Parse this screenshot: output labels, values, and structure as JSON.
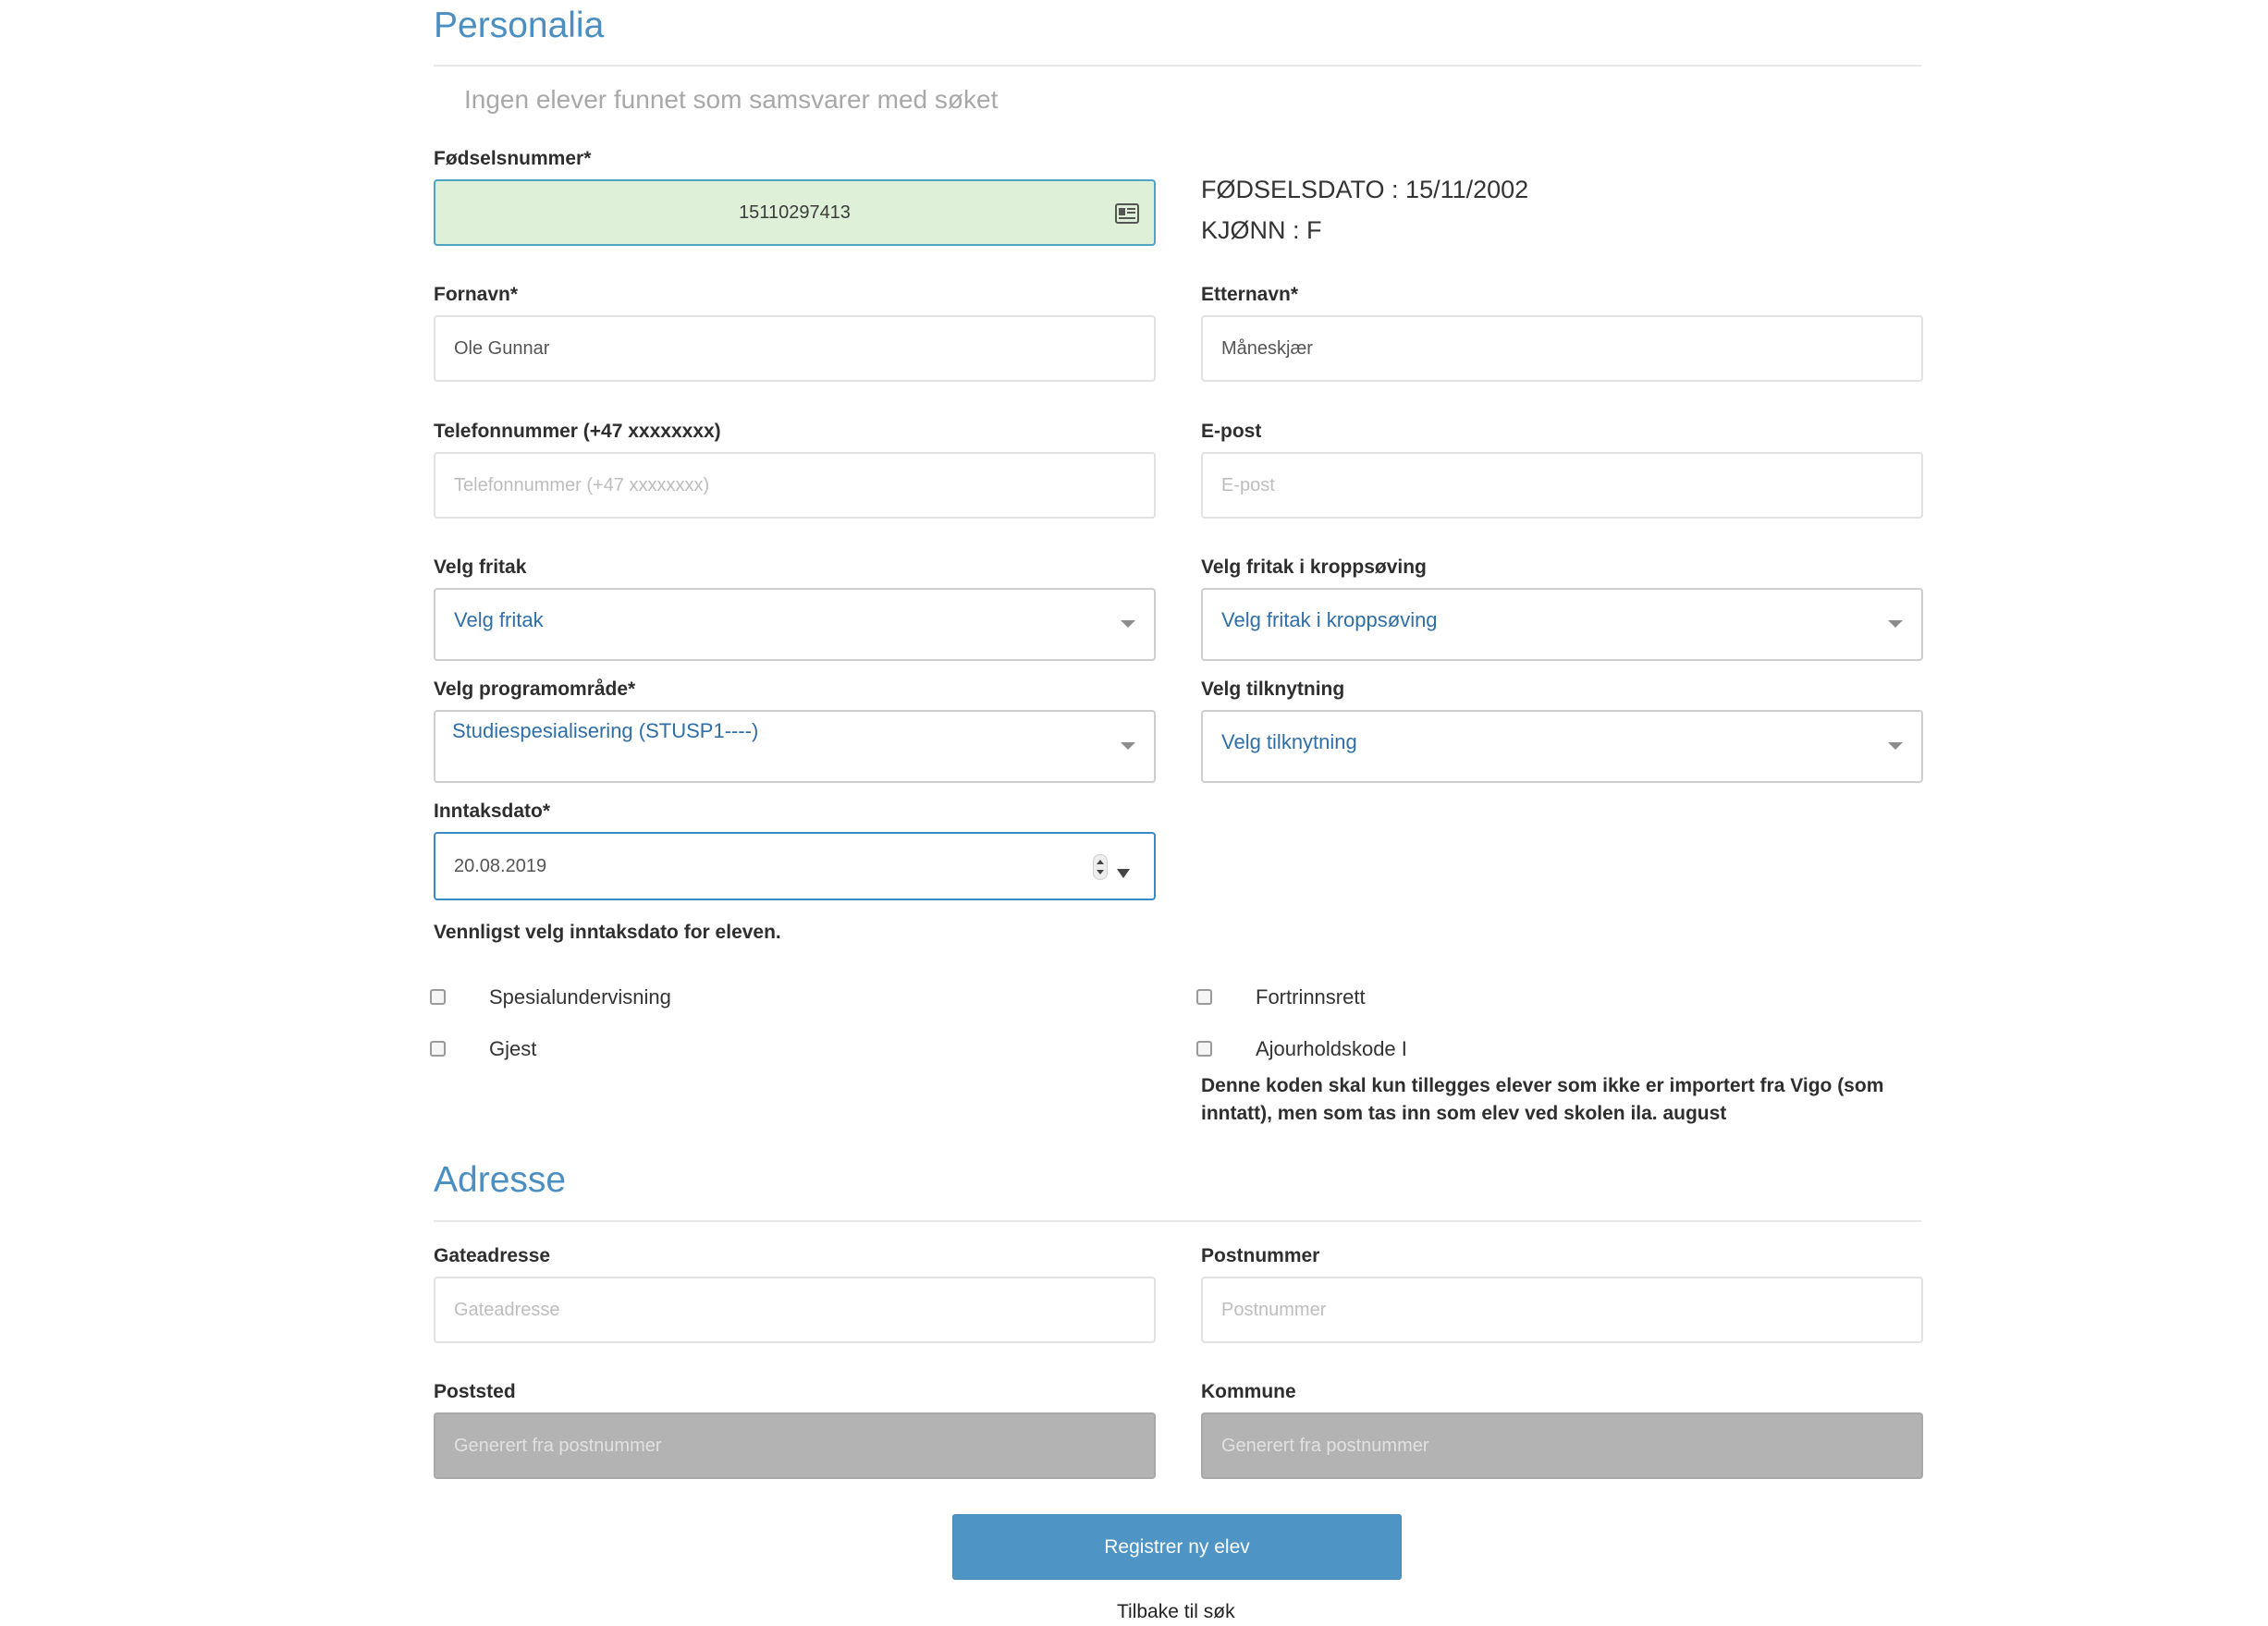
{
  "personalia": {
    "title": "Personalia",
    "notice": "Ingen elever funnet som samsvarer med søket",
    "fodselsnummer_label": "Fødselsnummer*",
    "fodselsnummer_value": "15110297413",
    "fodselsdato": "FØDSELSDATO : 15/11/2002",
    "kjonn": "KJØNN : F",
    "fornavn_label": "Fornavn*",
    "fornavn_value": "Ole Gunnar",
    "etternavn_label": "Etternavn*",
    "etternavn_value": "Måneskjær",
    "telefon_label": "Telefonnummer (+47 xxxxxxxx)",
    "telefon_placeholder": "Telefonnummer (+47 xxxxxxxx)",
    "epost_label": "E-post",
    "epost_placeholder": "E-post",
    "fritak_label": "Velg fritak",
    "fritak_value": "Velg fritak",
    "fritak_kropp_label": "Velg fritak i kroppsøving",
    "fritak_kropp_value": "Velg fritak i kroppsøving",
    "programomrade_label": "Velg programområde*",
    "programomrade_value": "Studiespesialisering (STUSP1----)",
    "tilknytning_label": "Velg tilknytning",
    "tilknytning_value": "Velg tilknytning",
    "inntaksdato_label": "Inntaksdato*",
    "inntaksdato_value": "20.08.2019",
    "inntaksdato_help": "Vennligst velg inntaksdato for eleven.",
    "checkboxes": {
      "spesialundervisning": "Spesialundervisning",
      "gjest": "Gjest",
      "fortrinnsrett": "Fortrinnsrett",
      "ajourholdskode": "Ajourholdskode I"
    },
    "ajourhold_help_line1": "Denne koden skal kun tillegges elever som ikke er importert fra Vigo (som",
    "ajourhold_help_line2": "inntatt), men som tas inn som elev ved skolen ila. august"
  },
  "adresse": {
    "title": "Adresse",
    "gateadresse_label": "Gateadresse",
    "gateadresse_placeholder": "Gateadresse",
    "postnummer_label": "Postnummer",
    "postnummer_placeholder": "Postnummer",
    "poststed_label": "Poststed",
    "poststed_placeholder": "Generert fra postnummer",
    "kommune_label": "Kommune",
    "kommune_placeholder": "Generert fra postnummer"
  },
  "actions": {
    "submit_label": "Registrer ny elev",
    "back_label": "Tilbake til søk"
  },
  "colors": {
    "accent": "#4a8ec2",
    "button": "#4e94c4",
    "success_bg": "#dff0d8"
  }
}
